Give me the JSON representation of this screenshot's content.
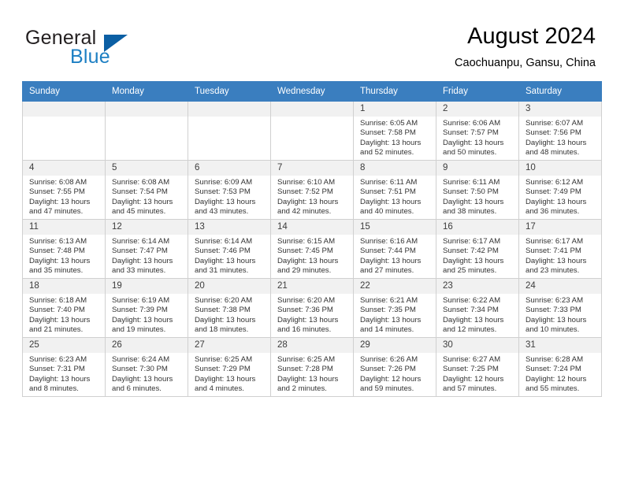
{
  "brand": {
    "name_part1": "General",
    "name_part2": "Blue",
    "triangle_color": "#0b5fa4",
    "blue_color": "#1d7fc3"
  },
  "header": {
    "title": "August 2024",
    "subtitle": "Caochuanpu, Gansu, China"
  },
  "theme": {
    "header_row_bg": "#3a7ebf",
    "daynum_bg": "#f1f1f1",
    "grid_border": "#d0d0d0"
  },
  "weekdays": [
    "Sunday",
    "Monday",
    "Tuesday",
    "Wednesday",
    "Thursday",
    "Friday",
    "Saturday"
  ],
  "labels": {
    "sunrise_prefix": "Sunrise:",
    "sunset_prefix": "Sunset:",
    "daylight_prefix": "Daylight:"
  },
  "weeks": [
    [
      {
        "day": "",
        "sunrise": "",
        "sunset": "",
        "daylight": ""
      },
      {
        "day": "",
        "sunrise": "",
        "sunset": "",
        "daylight": ""
      },
      {
        "day": "",
        "sunrise": "",
        "sunset": "",
        "daylight": ""
      },
      {
        "day": "",
        "sunrise": "",
        "sunset": "",
        "daylight": ""
      },
      {
        "day": "1",
        "sunrise": "Sunrise: 6:05 AM",
        "sunset": "Sunset: 7:58 PM",
        "daylight": "Daylight: 13 hours and 52 minutes."
      },
      {
        "day": "2",
        "sunrise": "Sunrise: 6:06 AM",
        "sunset": "Sunset: 7:57 PM",
        "daylight": "Daylight: 13 hours and 50 minutes."
      },
      {
        "day": "3",
        "sunrise": "Sunrise: 6:07 AM",
        "sunset": "Sunset: 7:56 PM",
        "daylight": "Daylight: 13 hours and 48 minutes."
      }
    ],
    [
      {
        "day": "4",
        "sunrise": "Sunrise: 6:08 AM",
        "sunset": "Sunset: 7:55 PM",
        "daylight": "Daylight: 13 hours and 47 minutes."
      },
      {
        "day": "5",
        "sunrise": "Sunrise: 6:08 AM",
        "sunset": "Sunset: 7:54 PM",
        "daylight": "Daylight: 13 hours and 45 minutes."
      },
      {
        "day": "6",
        "sunrise": "Sunrise: 6:09 AM",
        "sunset": "Sunset: 7:53 PM",
        "daylight": "Daylight: 13 hours and 43 minutes."
      },
      {
        "day": "7",
        "sunrise": "Sunrise: 6:10 AM",
        "sunset": "Sunset: 7:52 PM",
        "daylight": "Daylight: 13 hours and 42 minutes."
      },
      {
        "day": "8",
        "sunrise": "Sunrise: 6:11 AM",
        "sunset": "Sunset: 7:51 PM",
        "daylight": "Daylight: 13 hours and 40 minutes."
      },
      {
        "day": "9",
        "sunrise": "Sunrise: 6:11 AM",
        "sunset": "Sunset: 7:50 PM",
        "daylight": "Daylight: 13 hours and 38 minutes."
      },
      {
        "day": "10",
        "sunrise": "Sunrise: 6:12 AM",
        "sunset": "Sunset: 7:49 PM",
        "daylight": "Daylight: 13 hours and 36 minutes."
      }
    ],
    [
      {
        "day": "11",
        "sunrise": "Sunrise: 6:13 AM",
        "sunset": "Sunset: 7:48 PM",
        "daylight": "Daylight: 13 hours and 35 minutes."
      },
      {
        "day": "12",
        "sunrise": "Sunrise: 6:14 AM",
        "sunset": "Sunset: 7:47 PM",
        "daylight": "Daylight: 13 hours and 33 minutes."
      },
      {
        "day": "13",
        "sunrise": "Sunrise: 6:14 AM",
        "sunset": "Sunset: 7:46 PM",
        "daylight": "Daylight: 13 hours and 31 minutes."
      },
      {
        "day": "14",
        "sunrise": "Sunrise: 6:15 AM",
        "sunset": "Sunset: 7:45 PM",
        "daylight": "Daylight: 13 hours and 29 minutes."
      },
      {
        "day": "15",
        "sunrise": "Sunrise: 6:16 AM",
        "sunset": "Sunset: 7:44 PM",
        "daylight": "Daylight: 13 hours and 27 minutes."
      },
      {
        "day": "16",
        "sunrise": "Sunrise: 6:17 AM",
        "sunset": "Sunset: 7:42 PM",
        "daylight": "Daylight: 13 hours and 25 minutes."
      },
      {
        "day": "17",
        "sunrise": "Sunrise: 6:17 AM",
        "sunset": "Sunset: 7:41 PM",
        "daylight": "Daylight: 13 hours and 23 minutes."
      }
    ],
    [
      {
        "day": "18",
        "sunrise": "Sunrise: 6:18 AM",
        "sunset": "Sunset: 7:40 PM",
        "daylight": "Daylight: 13 hours and 21 minutes."
      },
      {
        "day": "19",
        "sunrise": "Sunrise: 6:19 AM",
        "sunset": "Sunset: 7:39 PM",
        "daylight": "Daylight: 13 hours and 19 minutes."
      },
      {
        "day": "20",
        "sunrise": "Sunrise: 6:20 AM",
        "sunset": "Sunset: 7:38 PM",
        "daylight": "Daylight: 13 hours and 18 minutes."
      },
      {
        "day": "21",
        "sunrise": "Sunrise: 6:20 AM",
        "sunset": "Sunset: 7:36 PM",
        "daylight": "Daylight: 13 hours and 16 minutes."
      },
      {
        "day": "22",
        "sunrise": "Sunrise: 6:21 AM",
        "sunset": "Sunset: 7:35 PM",
        "daylight": "Daylight: 13 hours and 14 minutes."
      },
      {
        "day": "23",
        "sunrise": "Sunrise: 6:22 AM",
        "sunset": "Sunset: 7:34 PM",
        "daylight": "Daylight: 13 hours and 12 minutes."
      },
      {
        "day": "24",
        "sunrise": "Sunrise: 6:23 AM",
        "sunset": "Sunset: 7:33 PM",
        "daylight": "Daylight: 13 hours and 10 minutes."
      }
    ],
    [
      {
        "day": "25",
        "sunrise": "Sunrise: 6:23 AM",
        "sunset": "Sunset: 7:31 PM",
        "daylight": "Daylight: 13 hours and 8 minutes."
      },
      {
        "day": "26",
        "sunrise": "Sunrise: 6:24 AM",
        "sunset": "Sunset: 7:30 PM",
        "daylight": "Daylight: 13 hours and 6 minutes."
      },
      {
        "day": "27",
        "sunrise": "Sunrise: 6:25 AM",
        "sunset": "Sunset: 7:29 PM",
        "daylight": "Daylight: 13 hours and 4 minutes."
      },
      {
        "day": "28",
        "sunrise": "Sunrise: 6:25 AM",
        "sunset": "Sunset: 7:28 PM",
        "daylight": "Daylight: 13 hours and 2 minutes."
      },
      {
        "day": "29",
        "sunrise": "Sunrise: 6:26 AM",
        "sunset": "Sunset: 7:26 PM",
        "daylight": "Daylight: 12 hours and 59 minutes."
      },
      {
        "day": "30",
        "sunrise": "Sunrise: 6:27 AM",
        "sunset": "Sunset: 7:25 PM",
        "daylight": "Daylight: 12 hours and 57 minutes."
      },
      {
        "day": "31",
        "sunrise": "Sunrise: 6:28 AM",
        "sunset": "Sunset: 7:24 PM",
        "daylight": "Daylight: 12 hours and 55 minutes."
      }
    ]
  ]
}
